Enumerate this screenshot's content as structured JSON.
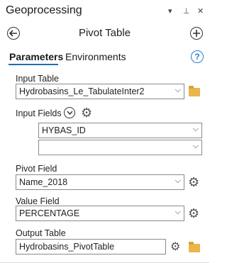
{
  "pane": {
    "title": "Geoprocessing",
    "controls": {
      "menu": "▾",
      "pin": "⊥",
      "close": "✕"
    }
  },
  "tool": {
    "title": "Pivot Table"
  },
  "tabs": [
    {
      "label": "Parameters",
      "active": true
    },
    {
      "label": "Environments",
      "active": false
    }
  ],
  "help_label": "?",
  "params": {
    "input_table": {
      "label": "Input Table",
      "value": "Hydrobasins_Le_TabulateInter2"
    },
    "input_fields": {
      "label": "Input Fields",
      "values": [
        "HYBAS_ID",
        ""
      ]
    },
    "pivot_field": {
      "label": "Pivot Field",
      "value": "Name_2018"
    },
    "value_field": {
      "label": "Value Field",
      "value": "PERCENTAGE"
    },
    "output_table": {
      "label": "Output Table",
      "value": "Hydrobasins_PivotTable"
    }
  },
  "colors": {
    "accent": "#1f6fb5",
    "help": "#2a7dd1",
    "folder": "#e8b64a"
  }
}
